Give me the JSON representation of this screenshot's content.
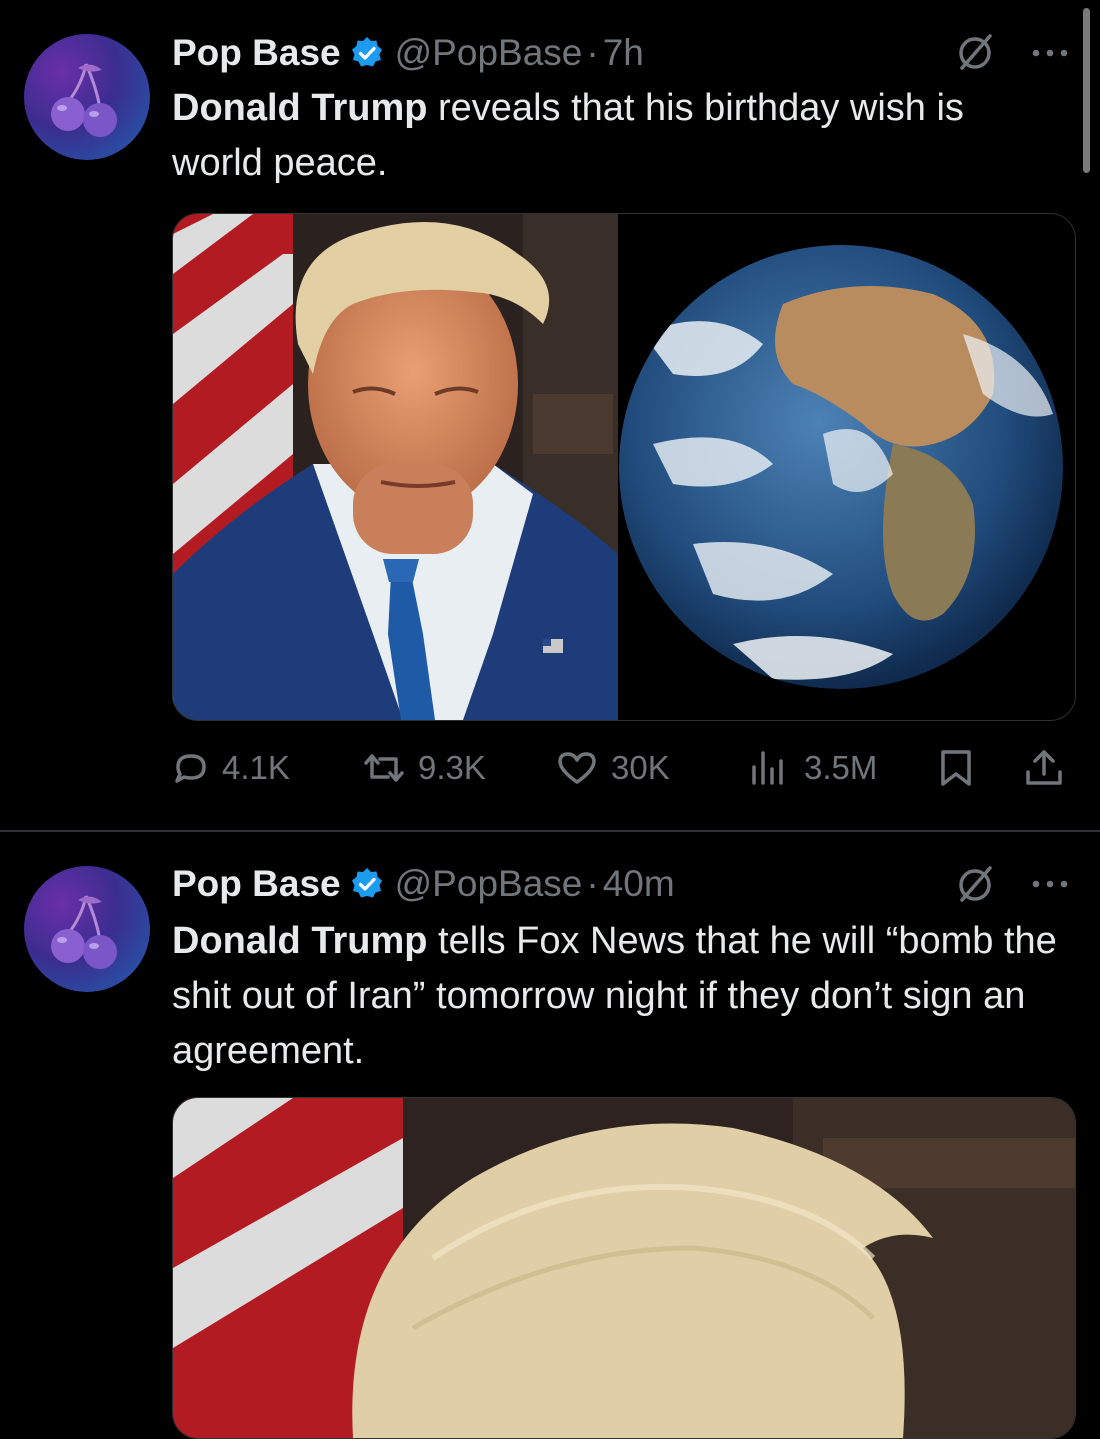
{
  "tweets": [
    {
      "author": {
        "display_name": "Pop Base",
        "handle": "@PopBase",
        "verified": true,
        "avatar_icon": "cherry-icon"
      },
      "time": "7h",
      "text_bold": "Donald Trump",
      "text_rest": " reveals that his birthday wish is world peace.",
      "media": [
        "portrait-photo",
        "earth-photo"
      ],
      "metrics": {
        "replies": "4.1K",
        "reposts": "9.3K",
        "likes": "30K",
        "views": "3.5M"
      }
    },
    {
      "author": {
        "display_name": "Pop Base",
        "handle": "@PopBase",
        "verified": true,
        "avatar_icon": "cherry-icon"
      },
      "time": "40m",
      "text_bold": "Donald Trump",
      "text_rest": " tells Fox News that he will “bomb the shit out of Iran” tomorrow night if they don’t sign an agreement.",
      "media": [
        "portrait-photo"
      ]
    }
  ],
  "separator": "·",
  "colors": {
    "background": "#000000",
    "text": "#e7e9ea",
    "secondary_text": "#71767b",
    "verified_badge": "#1d9bf0",
    "divider": "#2f3336"
  }
}
